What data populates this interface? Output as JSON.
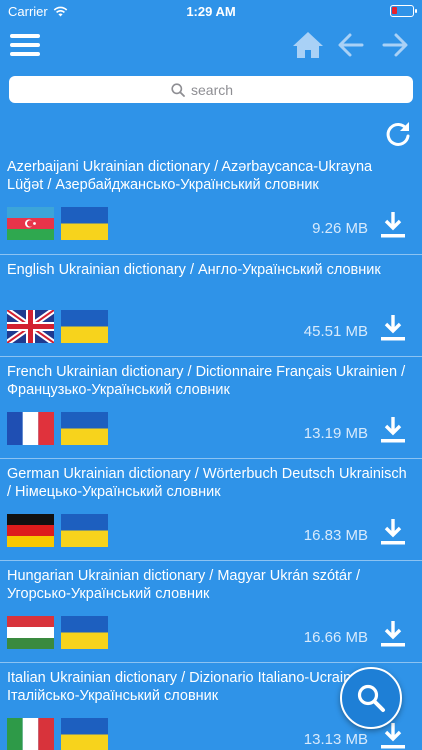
{
  "status_bar": {
    "carrier": "Carrier",
    "time": "1:29 AM"
  },
  "nav": {
    "icons": {
      "menu": "menu-icon",
      "home": "home-icon",
      "back": "arrow-left-icon",
      "forward": "arrow-right-icon"
    }
  },
  "search": {
    "placeholder": "search"
  },
  "colors": {
    "background": "#2f93e8",
    "fab": "#1e7fd6",
    "text": "#ffffff",
    "size_text": "#d7eafc",
    "battery_level": "#e8212b"
  },
  "dictionaries": [
    {
      "title": "Azerbaijani Ukrainian dictionary / Azərbaycanca-Ukrayna Lüğət / Азербайджансько-Український словник",
      "size": "9.26 MB",
      "flag": "azerbaijan"
    },
    {
      "title": "English Ukrainian dictionary / Англо-Український словник",
      "size": "45.51 MB",
      "flag": "uk"
    },
    {
      "title": "French Ukrainian dictionary / Dictionnaire Français Ukrainien / Французько-Український словник",
      "size": "13.19 MB",
      "flag": "france"
    },
    {
      "title": "German Ukrainian dictionary / Wörterbuch Deutsch Ukrainisch / Німецько-Український словник",
      "size": "16.83 MB",
      "flag": "germany"
    },
    {
      "title": "Hungarian Ukrainian dictionary / Magyar Ukrán szótár / Угорсько-Український словник",
      "size": "16.66 MB",
      "flag": "hungary"
    },
    {
      "title": "Italian Ukrainian dictionary / Dizionario Italiano-Ucraino / Італійсько-Український словник",
      "size": "13.13 MB",
      "flag": "italy"
    }
  ]
}
